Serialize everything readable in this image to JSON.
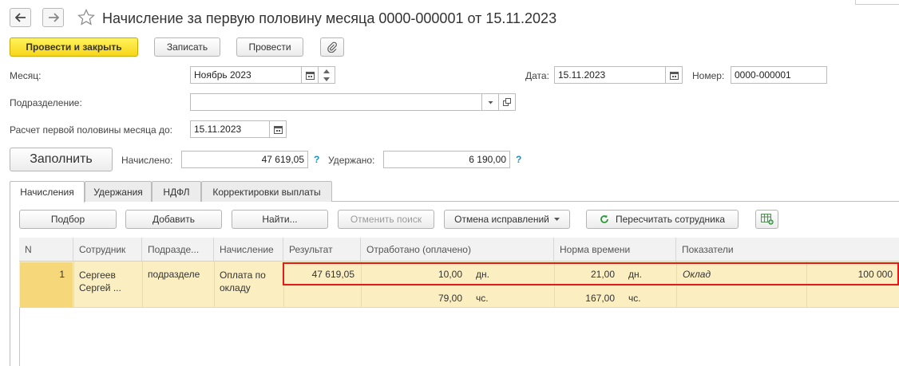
{
  "window": {
    "title": "Начисление за первую половину месяца 0000-000001 от 15.11.2023"
  },
  "toolbar": {
    "post_close_label": "Провести и закрыть",
    "save_label": "Записать",
    "post_label": "Провести"
  },
  "header": {
    "month_label": "Месяц:",
    "month_value": "Ноябрь 2023",
    "date_label": "Дата:",
    "date_value": "15.11.2023",
    "number_label": "Номер:",
    "number_value": "0000-000001",
    "department_label": "Подразделение:",
    "department_value": "",
    "calc_until_label": "Расчет первой половины месяца до:",
    "calc_until_value": "15.11.2023"
  },
  "summary": {
    "fill_label": "Заполнить",
    "accrued_label": "Начислено:",
    "accrued_value": "47 619,05",
    "withheld_label": "Удержано:",
    "withheld_value": "6 190,00",
    "help_symbol": "?"
  },
  "tabs": [
    {
      "label": "Начисления",
      "active": true
    },
    {
      "label": "Удержания",
      "active": false
    },
    {
      "label": "НДФЛ",
      "active": false
    },
    {
      "label": "Корректировки выплаты",
      "active": false
    }
  ],
  "table_toolbar": {
    "pick_label": "Подбор",
    "add_label": "Добавить",
    "find_label": "Найти...",
    "cancel_search_label": "Отменить поиск",
    "cancel_corrections_label": "Отмена исправлений",
    "recalc_label": "Пересчитать сотрудника"
  },
  "table": {
    "columns": [
      "N",
      "Сотрудник",
      "Подразде...",
      "Начисление",
      "Результат",
      "Отработано (оплачено)",
      "Норма времени",
      "Показатели"
    ],
    "rows": [
      {
        "n": "1",
        "employee": "Сергеев Сергей ...",
        "department": "подразделе",
        "accrual": "Оплата по окладу",
        "result": "47 619,05",
        "worked_days": "10,00",
        "worked_days_unit": "дн.",
        "worked_hours": "79,00",
        "worked_hours_unit": "чс.",
        "norm_days": "21,00",
        "norm_days_unit": "дн.",
        "norm_hours": "167,00",
        "norm_hours_unit": "чс.",
        "indicator_name": "Оклад",
        "indicator_value": "100 000"
      }
    ]
  },
  "colors": {
    "primary_button": "#f7d61a",
    "row_selected": "#fbefc2",
    "highlight_frame": "#e21b1b",
    "help": "#1a8fbf",
    "recalc_icon": "#2e9a3c"
  }
}
